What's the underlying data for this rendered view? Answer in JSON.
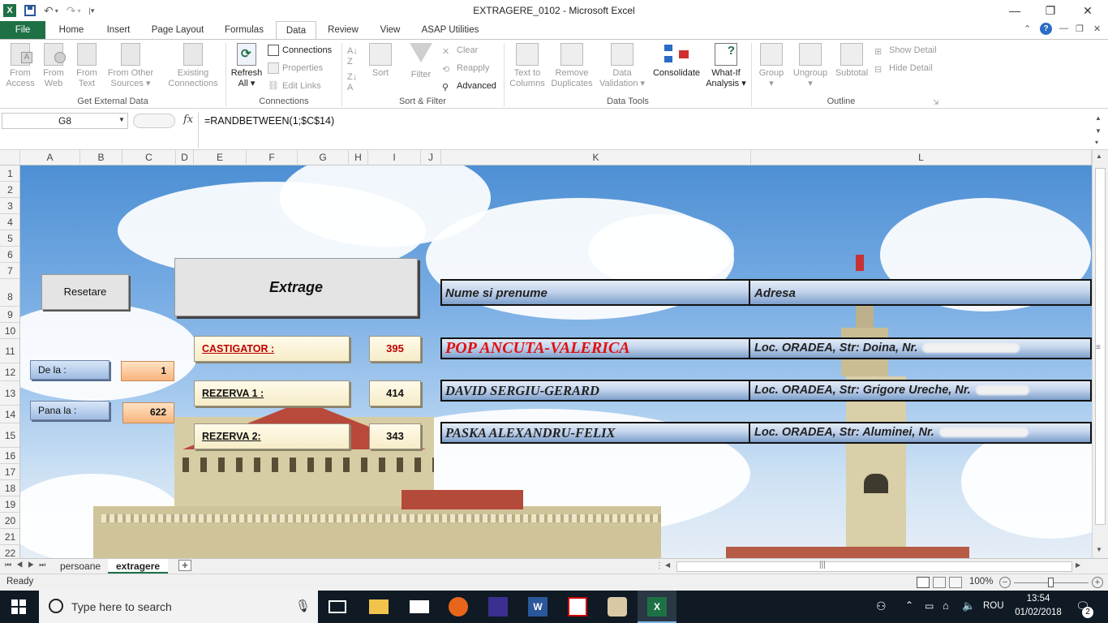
{
  "window": {
    "title": "EXTRAGERE_0102  -  Microsoft Excel",
    "controls": {
      "minimize": "—",
      "restore": "❐",
      "close": "✕"
    }
  },
  "qat": {
    "save": "save-icon",
    "undo": "undo-icon",
    "redo": "redo-icon"
  },
  "ribbon_tabs": [
    "File",
    "Home",
    "Insert",
    "Page Layout",
    "Formulas",
    "Data",
    "Review",
    "View",
    "ASAP Utilities"
  ],
  "active_tab": "Data",
  "ribbon": {
    "get_external_data": {
      "label": "Get External Data",
      "buttons": [
        {
          "line1": "From",
          "line2": "Access"
        },
        {
          "line1": "From",
          "line2": "Web"
        },
        {
          "line1": "From",
          "line2": "Text"
        },
        {
          "line1": "From Other",
          "line2": "Sources ▾"
        },
        {
          "line1": "Existing",
          "line2": "Connections"
        }
      ]
    },
    "connections": {
      "label": "Connections",
      "refresh": {
        "line1": "Refresh",
        "line2": "All ▾"
      },
      "items": [
        "Connections",
        "Properties",
        "Edit Links"
      ]
    },
    "sort_filter": {
      "label": "Sort & Filter",
      "sort": "Sort",
      "filter": "Filter",
      "items": [
        "Clear",
        "Reapply",
        "Advanced"
      ]
    },
    "data_tools": {
      "label": "Data Tools",
      "buttons": [
        {
          "line1": "Text to",
          "line2": "Columns"
        },
        {
          "line1": "Remove",
          "line2": "Duplicates"
        },
        {
          "line1": "Data",
          "line2": "Validation ▾"
        },
        {
          "line1": "Consolidate",
          "line2": ""
        },
        {
          "line1": "What-If",
          "line2": "Analysis ▾"
        }
      ]
    },
    "outline": {
      "label": "Outline",
      "buttons": [
        {
          "line1": "Group",
          "line2": "▾"
        },
        {
          "line1": "Ungroup",
          "line2": "▾"
        },
        {
          "line1": "Subtotal",
          "line2": ""
        }
      ],
      "items": [
        "Show Detail",
        "Hide Detail"
      ]
    }
  },
  "formula_bar": {
    "name_box": "G8",
    "fx": "fx",
    "formula": "=RANDBETWEEN(1;$C$14)"
  },
  "columns": [
    "A",
    "B",
    "C",
    "D",
    "E",
    "F",
    "G",
    "H",
    "I",
    "J",
    "K",
    "L"
  ],
  "rows": [
    "1",
    "2",
    "3",
    "4",
    "5",
    "6",
    "7",
    "8",
    "9",
    "10",
    "11",
    "12",
    "13",
    "14",
    "15",
    "16",
    "17",
    "18",
    "19",
    "20",
    "21",
    "22"
  ],
  "sheet": {
    "reset_button": "Resetare",
    "extract_button": "Extrage",
    "from_label": "De la :",
    "from_value": "1",
    "to_label": "Pana la :",
    "to_value": "622",
    "winner_label": "CASTIGATOR :",
    "winner_number": "395",
    "reserve1_label": "REZERVA 1 :",
    "reserve1_number": "414",
    "reserve2_label": "REZERVA 2:",
    "reserve2_number": "343",
    "header_name": "Nume si prenume",
    "header_address": "Adresa",
    "winner_name": "POP ANCUTA-VALERICA",
    "winner_address": "Loc. ORADEA, Str: Doina, Nr.",
    "reserve1_name": "DAVID SERGIU-GERARD",
    "reserve1_address": "Loc. ORADEA, Str: Grigore Ureche, Nr.",
    "reserve2_name": "PASKA ALEXANDRU-FELIX",
    "reserve2_address": "Loc. ORADEA, Str: Aluminei, Nr."
  },
  "sheet_tabs": [
    "persoane",
    "extragere"
  ],
  "active_sheet": "extragere",
  "status": {
    "ready": "Ready",
    "zoom": "100%"
  },
  "taskbar": {
    "search_placeholder": "Type here to search",
    "language": "ROU",
    "time": "13:54",
    "date": "01/02/2018",
    "notifications": "2"
  },
  "colors": {
    "excel_green": "#1e7145",
    "winner_red": "#e01010",
    "label_red": "#c00000"
  }
}
